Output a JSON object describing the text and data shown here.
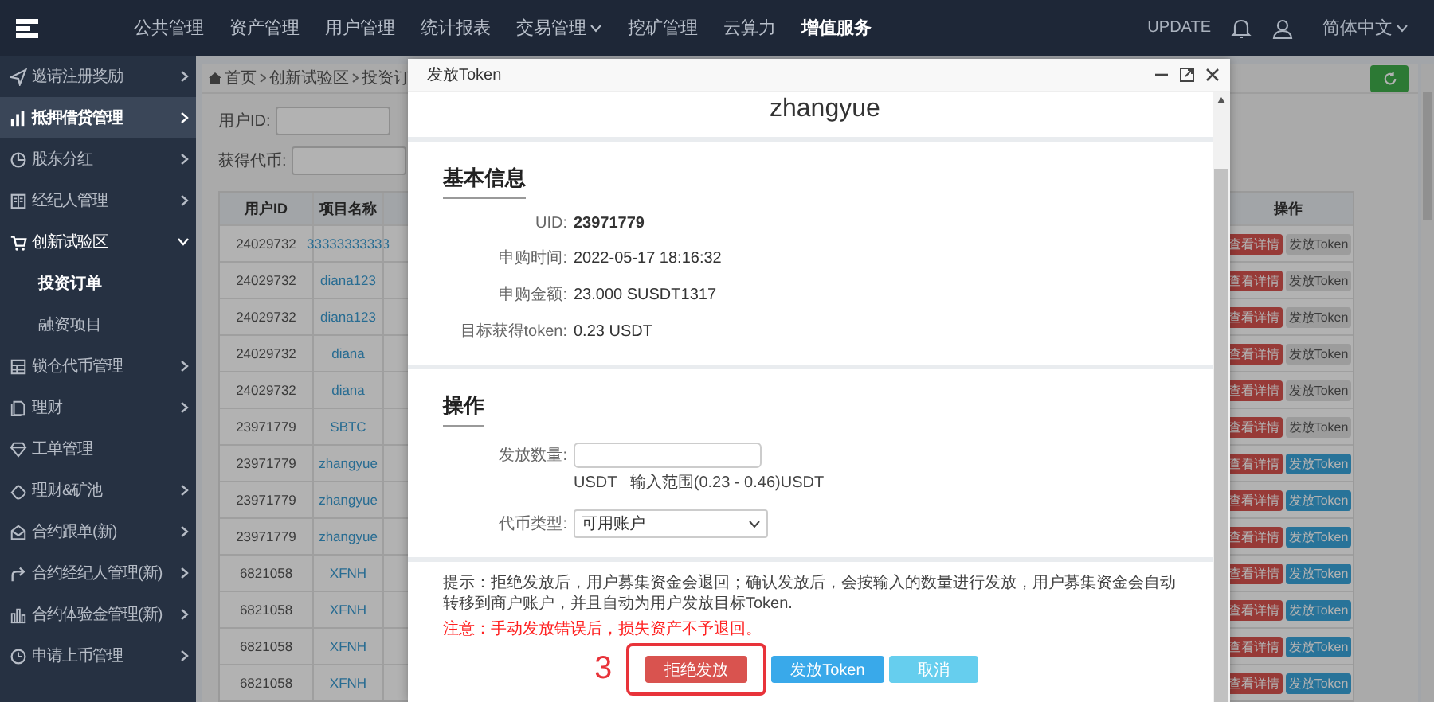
{
  "topbar": {
    "menu": [
      {
        "label": "公共管理",
        "selected": false,
        "dropdown": false
      },
      {
        "label": "资产管理",
        "selected": false,
        "dropdown": false
      },
      {
        "label": "用户管理",
        "selected": false,
        "dropdown": false
      },
      {
        "label": "统计报表",
        "selected": false,
        "dropdown": false
      },
      {
        "label": "交易管理",
        "selected": false,
        "dropdown": true
      },
      {
        "label": "挖矿管理",
        "selected": false,
        "dropdown": false
      },
      {
        "label": "云算力",
        "selected": false,
        "dropdown": false
      },
      {
        "label": "增值服务",
        "selected": true,
        "dropdown": false
      }
    ],
    "update": "UPDATE",
    "language": "简体中文"
  },
  "sidebar": {
    "items": [
      {
        "label": "邀请注册奖励",
        "selected": false,
        "expanded": false,
        "arrow": true
      },
      {
        "label": "抵押借贷管理",
        "selected": true,
        "expanded": false,
        "arrow": true
      },
      {
        "label": "股东分红",
        "selected": false,
        "expanded": false,
        "arrow": true
      },
      {
        "label": "经纪人管理",
        "selected": false,
        "expanded": false,
        "arrow": true
      },
      {
        "label": "创新试验区",
        "selected": false,
        "expanded": true,
        "arrow": true,
        "children": [
          {
            "label": "投资订单",
            "selected": true
          },
          {
            "label": "融资项目",
            "selected": false
          }
        ]
      },
      {
        "label": "锁仓代币管理",
        "selected": false,
        "expanded": false,
        "arrow": true
      },
      {
        "label": "理财",
        "selected": false,
        "expanded": false,
        "arrow": true
      },
      {
        "label": "工单管理",
        "selected": false,
        "expanded": false,
        "arrow": false
      },
      {
        "label": "理财&矿池",
        "selected": false,
        "expanded": false,
        "arrow": true
      },
      {
        "label": "合约跟单(新)",
        "selected": false,
        "expanded": false,
        "arrow": true
      },
      {
        "label": "合约经纪人管理(新)",
        "selected": false,
        "expanded": false,
        "arrow": true
      },
      {
        "label": "合约体验金管理(新)",
        "selected": false,
        "expanded": false,
        "arrow": true
      },
      {
        "label": "申请上币管理",
        "selected": false,
        "expanded": false,
        "arrow": true
      }
    ]
  },
  "breadcrumb": [
    "首页",
    "创新试验区",
    "投资订"
  ],
  "filters": [
    {
      "label": "用户ID:"
    },
    {
      "label": "获得代币:"
    }
  ],
  "table": {
    "columns": [
      "用户ID",
      "项目名称",
      "操作"
    ],
    "rows": [
      {
        "user_id": "24029732",
        "project": "33333333333",
        "actions": [
          {
            "label": "查看详情",
            "kind": "view"
          },
          {
            "label": "发放Token",
            "kind": "issue",
            "disabled": true
          }
        ]
      },
      {
        "user_id": "24029732",
        "project": "diana123",
        "actions": [
          {
            "label": "查看详情",
            "kind": "view"
          },
          {
            "label": "发放Token",
            "kind": "issue",
            "disabled": true
          }
        ]
      },
      {
        "user_id": "24029732",
        "project": "diana123",
        "actions": [
          {
            "label": "查看详情",
            "kind": "view"
          },
          {
            "label": "发放Token",
            "kind": "issue",
            "disabled": true
          }
        ]
      },
      {
        "user_id": "24029732",
        "project": "diana",
        "actions": [
          {
            "label": "查看详情",
            "kind": "view"
          },
          {
            "label": "发放Token",
            "kind": "issue",
            "disabled": true
          }
        ]
      },
      {
        "user_id": "24029732",
        "project": "diana",
        "actions": [
          {
            "label": "查看详情",
            "kind": "view"
          },
          {
            "label": "发放Token",
            "kind": "issue",
            "disabled": true
          }
        ]
      },
      {
        "user_id": "23971779",
        "project": "SBTC",
        "actions": [
          {
            "label": "查看详情",
            "kind": "view"
          },
          {
            "label": "发放Token",
            "kind": "issue",
            "disabled": true
          }
        ]
      },
      {
        "user_id": "23971779",
        "project": "zhangyue",
        "actions": [
          {
            "label": "查看详情",
            "kind": "view"
          },
          {
            "label": "发放Token",
            "kind": "issue",
            "disabled": false
          }
        ]
      },
      {
        "user_id": "23971779",
        "project": "zhangyue",
        "actions": [
          {
            "label": "查看详情",
            "kind": "view"
          },
          {
            "label": "发放Token",
            "kind": "issue",
            "disabled": false
          }
        ]
      },
      {
        "user_id": "23971779",
        "project": "zhangyue",
        "actions": [
          {
            "label": "查看详情",
            "kind": "view"
          },
          {
            "label": "发放Token",
            "kind": "issue",
            "disabled": false
          }
        ]
      },
      {
        "user_id": "6821058",
        "project": "XFNH",
        "actions": [
          {
            "label": "查看详情",
            "kind": "view"
          },
          {
            "label": "发放Token",
            "kind": "issue",
            "disabled": false
          }
        ]
      },
      {
        "user_id": "6821058",
        "project": "XFNH",
        "actions": [
          {
            "label": "查看详情",
            "kind": "view"
          },
          {
            "label": "发放Token",
            "kind": "issue",
            "disabled": false
          }
        ]
      },
      {
        "user_id": "6821058",
        "project": "XFNH",
        "actions": [
          {
            "label": "查看详情",
            "kind": "view"
          },
          {
            "label": "发放Token",
            "kind": "issue",
            "disabled": false
          }
        ]
      },
      {
        "user_id": "6821058",
        "project": "XFNH",
        "actions": [
          {
            "label": "查看详情",
            "kind": "view"
          },
          {
            "label": "发放Token",
            "kind": "issue",
            "disabled": false
          }
        ]
      }
    ]
  },
  "modal": {
    "title": "发放Token",
    "name": "zhangyue",
    "basic": {
      "heading": "基本信息",
      "fields": [
        {
          "label": "UID:",
          "value": "23971779",
          "kind": "strong"
        },
        {
          "label": "申购时间:",
          "value": "2022-05-17 18:16:32",
          "kind": "plain"
        },
        {
          "label": "申购金额:",
          "value": "23.000 SUSDT1317",
          "kind": "plain"
        },
        {
          "label": "目标获得token:",
          "value": "0.23 USDT",
          "kind": "plain"
        }
      ]
    },
    "operation": {
      "heading": "操作",
      "amount_label": "发放数量:",
      "amount_hint": "USDT   输入范围(0.23 - 0.46)USDT",
      "type_label": "代币类型:",
      "type_value": "可用账户"
    },
    "tip": "提示：拒绝发放后，用户募集资金会退回；确认发放后，会按输入的数量进行发放，用户募集资金会自动转移到商户账户，并且自动为用户发放目标Token.",
    "warning": "注意：手动发放错误后，损失资产不予退回。",
    "buttons": [
      {
        "label": "拒绝发放",
        "kind": "reject",
        "annotation": "3"
      },
      {
        "label": "发放Token",
        "kind": "confirm"
      },
      {
        "label": "取消",
        "kind": "cancel"
      }
    ]
  }
}
